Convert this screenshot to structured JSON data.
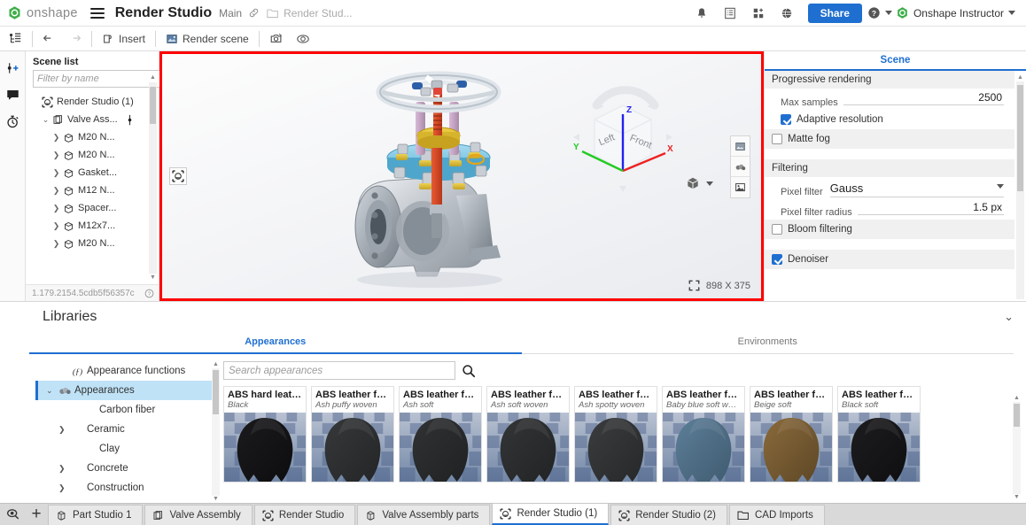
{
  "header": {
    "logo_icon": "onshape-logo-icon",
    "brand": "onshape",
    "menu_icon": "hamburger-menu-icon",
    "document_title": "Render Studio",
    "branch": "Main",
    "link_icon": "link-icon",
    "folder_icon": "folder-icon",
    "breadcrumb": "Render Stud...",
    "icons": [
      {
        "name": "bell-icon",
        "label": "Notifications"
      },
      {
        "name": "list-detail-icon",
        "label": "Details"
      },
      {
        "name": "apps-grid-icon",
        "label": "Apps"
      },
      {
        "name": "globe-icon",
        "label": "Public"
      }
    ],
    "share_label": "Share",
    "help_icon": "help-circle-icon",
    "user_name": "Onshape Instructor"
  },
  "toolbar": {
    "tree_icon": "feature-tree-icon",
    "undo_icon": "undo-arrow-icon",
    "redo_icon": "redo-arrow-icon",
    "insert_label": "Insert",
    "insert_icon": "insert-icon",
    "render_label": "Render scene",
    "render_icon": "render-scene-icon",
    "camera_icon": "camera-settings-icon",
    "env_icon": "environment-icon"
  },
  "icon_rail": [
    {
      "name": "add-scene-icon"
    },
    {
      "name": "comment-bubble-icon"
    },
    {
      "name": "history-stopwatch-icon"
    }
  ],
  "scene_panel": {
    "title": "Scene list",
    "filter_placeholder": "Filter by name",
    "list_view_icon": "list-view-icon",
    "tree": [
      {
        "label": "Render Studio (1)",
        "icon": "render-studio-icon",
        "arrow": "",
        "indent": 0
      },
      {
        "label": "Valve Ass...",
        "icon": "assembly-icon",
        "arrow": "expanded",
        "indent": 1,
        "trailing_icon": "mate-connector-icon"
      },
      {
        "label": "M20 N...",
        "icon": "part-icon",
        "arrow": "collapsed",
        "indent": 2
      },
      {
        "label": "M20 N...",
        "icon": "part-icon",
        "arrow": "collapsed",
        "indent": 2
      },
      {
        "label": "Gasket...",
        "icon": "part-icon",
        "arrow": "collapsed",
        "indent": 2
      },
      {
        "label": "M12 N...",
        "icon": "part-icon",
        "arrow": "collapsed",
        "indent": 2
      },
      {
        "label": "Spacer...",
        "icon": "part-icon",
        "arrow": "collapsed",
        "indent": 2
      },
      {
        "label": "M12x7...",
        "icon": "part-icon",
        "arrow": "collapsed",
        "indent": 2
      },
      {
        "label": "M20 N...",
        "icon": "part-icon",
        "arrow": "collapsed",
        "indent": 2
      }
    ],
    "version": "1.179.2154.5cdb5f56357c",
    "help_icon": "help-circle-small-icon"
  },
  "viewport": {
    "border_color": "#ff0000",
    "select_tool_icon": "select-render-icon",
    "tools": [
      {
        "name": "appearance-tool-icon"
      },
      {
        "name": "environment-tool-icon"
      },
      {
        "name": "image-tool-icon"
      }
    ],
    "viewcube": {
      "face_left": "Left",
      "face_front": "Front",
      "axis_x": "X",
      "axis_y": "Y",
      "axis_z": "Z",
      "axis_x_color": "#ee2222",
      "axis_y_color": "#22cc22",
      "axis_z_color": "#2222ee"
    },
    "render_mode_icon": "shaded-cube-icon",
    "resolution": "898 X 375",
    "expand_icon": "expand-corners-icon"
  },
  "right_panel": {
    "tab_label": "Scene",
    "sections": [
      {
        "type": "header",
        "label": "Progressive rendering"
      },
      {
        "type": "field",
        "label": "Max samples",
        "value": "2500"
      },
      {
        "type": "checkbox",
        "label": "Adaptive resolution",
        "checked": true
      },
      {
        "type": "checkbox-section",
        "label": "Matte fog",
        "checked": false
      },
      {
        "type": "header",
        "label": "Filtering"
      },
      {
        "type": "select",
        "label": "Pixel filter",
        "value": "Gauss"
      },
      {
        "type": "field",
        "label": "Pixel filter radius",
        "value": "1.5 px"
      },
      {
        "type": "checkbox-section",
        "label": "Bloom filtering",
        "checked": false
      },
      {
        "type": "checkbox-section",
        "label": "Denoiser",
        "checked": true
      }
    ]
  },
  "libraries": {
    "title": "Libraries",
    "collapse_icon": "chevron-down-icon",
    "tabs": [
      {
        "label": "Appearances",
        "active": true
      },
      {
        "label": "Environments",
        "active": false
      }
    ],
    "tree": [
      {
        "label": "Appearance functions",
        "icon": "function-icon",
        "arrow": "",
        "indent": 1,
        "selected": false
      },
      {
        "label": "Appearances",
        "icon": "appearances-icon",
        "arrow": "expanded",
        "indent": 0,
        "selected": true
      },
      {
        "label": "Carbon fiber",
        "icon": "",
        "arrow": "",
        "indent": 2,
        "selected": false
      },
      {
        "label": "Ceramic",
        "icon": "",
        "arrow": "collapsed",
        "indent": 1,
        "selected": false
      },
      {
        "label": "Clay",
        "icon": "",
        "arrow": "",
        "indent": 2,
        "selected": false
      },
      {
        "label": "Concrete",
        "icon": "",
        "arrow": "collapsed",
        "indent": 1,
        "selected": false
      },
      {
        "label": "Construction",
        "icon": "",
        "arrow": "collapsed",
        "indent": 1,
        "selected": false
      }
    ],
    "search_placeholder": "Search appearances",
    "search_icon": "search-icon",
    "cards": [
      {
        "title": "ABS hard leath...",
        "subtitle": "Black",
        "color": "#1b1b1d",
        "shade": "#0d0d0f"
      },
      {
        "title": "ABS leather fab...",
        "subtitle": "Ash puffy woven",
        "color": "#36383a",
        "shade": "#232527"
      },
      {
        "title": "ABS leather fab...",
        "subtitle": "Ash soft",
        "color": "#303234",
        "shade": "#1f2123"
      },
      {
        "title": "ABS leather fab...",
        "subtitle": "Ash soft woven",
        "color": "#333537",
        "shade": "#212325"
      },
      {
        "title": "ABS leather fab...",
        "subtitle": "Ash spotty woven",
        "color": "#3a3c3e",
        "shade": "#26282a"
      },
      {
        "title": "ABS leather fab...",
        "subtitle": "Baby blue soft woven",
        "color": "#5d7f99",
        "shade": "#3f5b70"
      },
      {
        "title": "ABS leather fab...",
        "subtitle": "Beige soft",
        "color": "#8a6a3c",
        "shade": "#5e4826"
      },
      {
        "title": "ABS leather fab...",
        "subtitle": "Black soft",
        "color": "#1d1d1f",
        "shade": "#0f0f11"
      }
    ]
  },
  "bottom_tabs": {
    "search_icon": "tab-search-icon",
    "add_label": "+",
    "tabs": [
      {
        "label": "Part Studio 1",
        "icon": "part-studio-icon",
        "active": false
      },
      {
        "label": "Valve Assembly",
        "icon": "assembly-icon",
        "active": false
      },
      {
        "label": "Render Studio",
        "icon": "render-studio-icon",
        "active": false
      },
      {
        "label": "Valve Assembly parts",
        "icon": "part-studio-icon",
        "active": false
      },
      {
        "label": "Render Studio (1)",
        "icon": "render-studio-icon",
        "active": true
      },
      {
        "label": "Render Studio (2)",
        "icon": "render-studio-icon",
        "active": false
      },
      {
        "label": "CAD Imports",
        "icon": "folder-icon",
        "active": false
      }
    ]
  }
}
